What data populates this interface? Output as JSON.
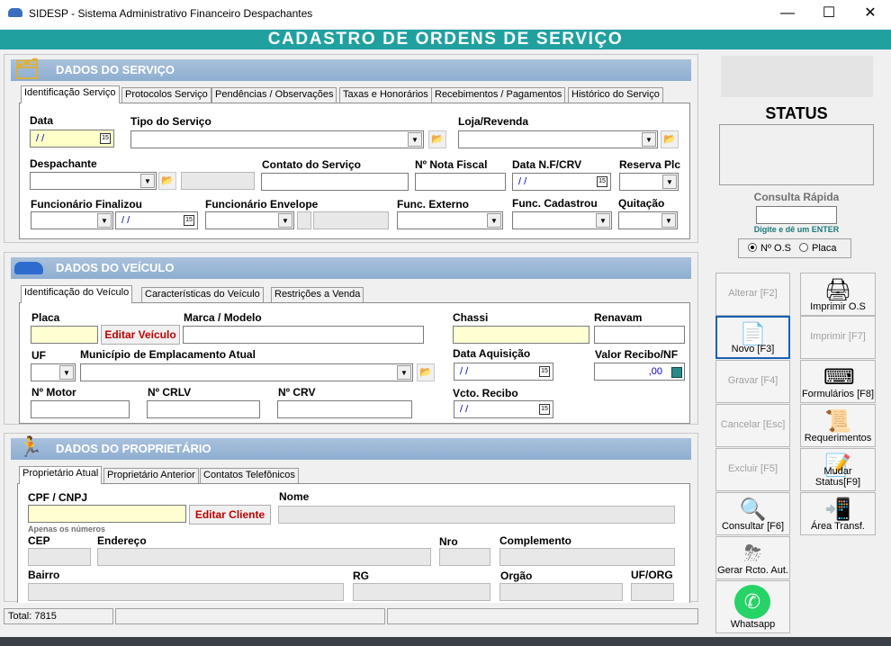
{
  "window": {
    "title": "SIDESP - Sistema Administrativo Financeiro Despachantes",
    "minimize": "—",
    "maximize": "☐",
    "close": "✕"
  },
  "banner": "CADASTRO DE ORDENS DE SERVIÇO",
  "servico": {
    "heading": "DADOS DO SERVIÇO",
    "tabs": [
      "Identificação Serviço",
      "Protocolos Serviço",
      "Pendências / Observações",
      "Taxas e Honorários",
      "Recebimentos / Pagamentos",
      "Histórico do Serviço"
    ],
    "labels": {
      "data": "Data",
      "tipo": "Tipo do Serviço",
      "loja": "Loja/Revenda",
      "despachante": "Despachante",
      "contato": "Contato do Serviço",
      "nota": "Nº Nota Fiscal",
      "data_nf": "Data N.F/CRV",
      "reserva": "Reserva Plc",
      "func_fin": "Funcionário Finalizou",
      "func_env": "Funcionário Envelope",
      "func_ext": "Func. Externo",
      "func_cad": "Func. Cadastrou",
      "quitacao": "Quitação"
    },
    "date_placeholder": " / /"
  },
  "veiculo": {
    "heading": "DADOS DO VEÍCULO",
    "tabs": [
      "Identificação do Veículo",
      "Características do Veículo",
      "Restrições a Venda"
    ],
    "labels": {
      "placa": "Placa",
      "marca": "Marca / Modelo",
      "chassi": "Chassi",
      "renavam": "Renavam",
      "uf": "UF",
      "municipio": "Município de Emplacamento Atual",
      "data_aq": "Data Aquisição",
      "valor": "Valor Recibo/NF",
      "motor": "Nº Motor",
      "crlv": "Nº CRLV",
      "crv": "Nº CRV",
      "vcto": "Vcto. Recibo"
    },
    "edit_button": "Editar Veículo",
    "valor": ",00",
    "date_placeholder": " / /"
  },
  "proprietario": {
    "heading": "DADOS DO PROPRIETÁRIO",
    "tabs": [
      "Proprietário Atual",
      "Proprietário Anterior",
      "Contatos Telefônicos"
    ],
    "labels": {
      "cpf": "CPF / CNPJ",
      "nome": "Nome",
      "hint": "Apenas os números",
      "cep": "CEP",
      "endereco": "Endereço",
      "nro": "Nro",
      "complemento": "Complemento",
      "bairro": "Bairro",
      "rg": "RG",
      "orgao": "Orgão",
      "uforg": "UF/ORG"
    },
    "edit_button": "Editar Cliente"
  },
  "right": {
    "status": "STATUS",
    "consulta": "Consulta Rápida",
    "hint": "Digite e dê um ENTER",
    "radio_os": "Nº O.S",
    "radio_placa": "Placa"
  },
  "buttons": {
    "alterar": "Alterar [F2]",
    "imprimir": "Imprimir O.S",
    "novo": "Novo [F3]",
    "imprimir2": "Imprimir [F7]",
    "gravar": "Gravar [F4]",
    "formularios": "Formulários [F8]",
    "cancelar": "Cancelar [Esc]",
    "requerimentos": "Requerimentos",
    "excluir": "Excluir [F5]",
    "mudar": "Mudar Status[F9]",
    "consultar": "Consultar [F6]",
    "area": "Área Transf.",
    "gerar": "Gerar Rcto. Aut.",
    "whatsapp": "Whatsapp"
  },
  "statusbar": {
    "total": "Total: 7815"
  },
  "colors": {
    "banner": "#21a0a0",
    "section": "#9ab8d8",
    "label_red": "#c00000"
  }
}
